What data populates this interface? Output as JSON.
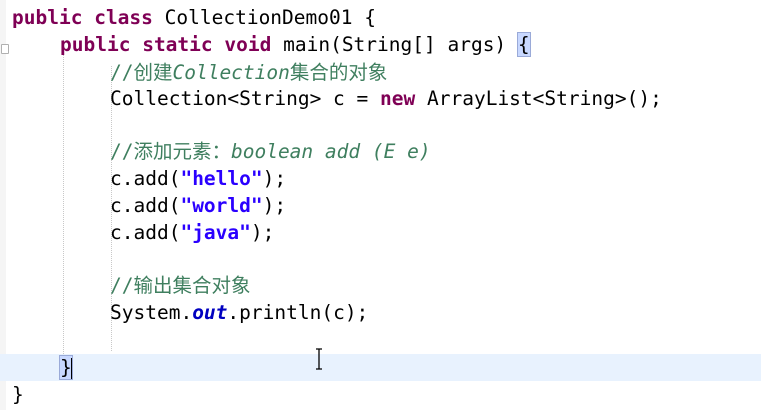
{
  "editor": {
    "lines": [
      [
        "public",
        " ",
        "class",
        " CollectionDemo01 {"
      ],
      [
        "public",
        " ",
        "static",
        " ",
        "void",
        " main(String[] args) ",
        "{"
      ],
      [
        "//创建",
        "Collection",
        "集合的对象"
      ],
      [
        "Collection<String> c = ",
        "new",
        " ArrayList<String>();"
      ],
      [
        "//添加元素：",
        "boolean add (E e)"
      ],
      [
        "c.add(",
        "\"hello\"",
        ");"
      ],
      [
        "c.add(",
        "\"world\"",
        ");"
      ],
      [
        "c.add(",
        "\"java\"",
        ");"
      ],
      [
        "//输出集合对象"
      ],
      [
        "System.",
        "out",
        ".println(c);"
      ],
      [
        "}"
      ],
      [
        "}"
      ]
    ]
  }
}
